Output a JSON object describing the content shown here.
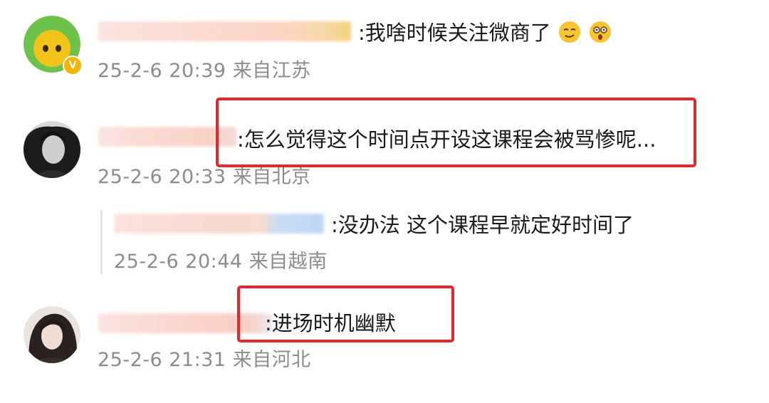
{
  "comments": [
    {
      "text": ":我啥时候关注微商了",
      "emojis": [
        "smug-face-emoji",
        "surprised-face-emoji"
      ],
      "date": "25-2-6 20:39",
      "location": "来自江苏",
      "verified_badge": "V"
    },
    {
      "text": ":怎么觉得这个时间点开设这课程会被骂惨呢...",
      "date": "25-2-6 20:33",
      "location": "来自北京"
    },
    {
      "text": ":没办法 这个课程早就定好时间了",
      "date": "25-2-6 20:44",
      "location": "来自越南"
    },
    {
      "text": ":进场时机幽默",
      "date": "25-2-6 21:31",
      "location": "来自河北"
    }
  ],
  "colors": {
    "highlight_border": "#e0282e",
    "meta_text": "#8c8c8c",
    "badge": "#f4b400"
  }
}
